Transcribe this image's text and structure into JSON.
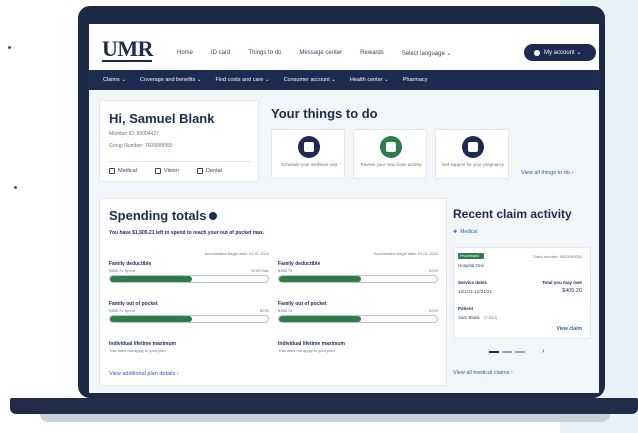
{
  "header": {
    "logo": "UMR",
    "nav": [
      "Home",
      "ID card",
      "Things to do",
      "Message center",
      "Rewards",
      "Select language ⌄"
    ],
    "account": "My account ⌄"
  },
  "subnav": [
    "Claims ⌄",
    "Coverage and benefits ⌄",
    "Find costs and care ⌄",
    "Consumer account ⌄",
    "Health center ⌄",
    "Pharmacy"
  ],
  "greeting": {
    "title": "Hi, Samuel Blank",
    "member_id": "Member ID: 99004427",
    "group": "Group Number: 7609999955",
    "coverage": [
      "Medical",
      "Vision",
      "Dental"
    ]
  },
  "things": {
    "title": "Your things to do",
    "items": [
      {
        "label": "Schedule your wellness visit"
      },
      {
        "label": "Review your new claim activity"
      },
      {
        "label": "Get support for your pregnancy"
      }
    ],
    "view_all": "View all things to do ›"
  },
  "spending": {
    "title": "Spending totals",
    "note": "You have $1,605.21 left to spend to reach your out of pocket max.",
    "accumulator_note": "Accumulator begin date: 01.01.2022",
    "left": {
      "deductible": {
        "label": "Family deductible",
        "spent": "$386.72 Spent",
        "max": "$750 Max",
        "fill": 0.52
      },
      "oop": {
        "label": "Family out of pocket",
        "spent": "$386.72 Spent",
        "max": "$750",
        "fill": 0.52
      },
      "lifetime": {
        "label": "Individual lifetime maximum",
        "sub": "This does not apply to your plan"
      }
    },
    "right": {
      "deductible": {
        "label": "Family deductible",
        "spent": "$386.72",
        "max": "$750",
        "fill": 0.52
      },
      "oop": {
        "label": "Family out of pocket",
        "spent": "$386.72",
        "max": "$750",
        "fill": 0.52
      },
      "lifetime": {
        "label": "Individual lifetime maximum",
        "sub": "This does not apply to your plan"
      }
    },
    "view_plan": "View additional plan details ›"
  },
  "claims": {
    "title": "Recent claim activity",
    "filter": "Medical",
    "status": "Processed",
    "claim_number": "Claim number: 0000000000",
    "provider": "Hospital One",
    "service_label": "Service dates",
    "service_dates": "12/1/21-12/31/21",
    "owe_label": "Total you may owe",
    "owe_amount": "$405.20",
    "patient_label": "Patient",
    "patient_name": "Sam Blank",
    "patient_tag": "(Child)",
    "view_claim": "View claim",
    "view_all": "View all medical claims ›"
  }
}
